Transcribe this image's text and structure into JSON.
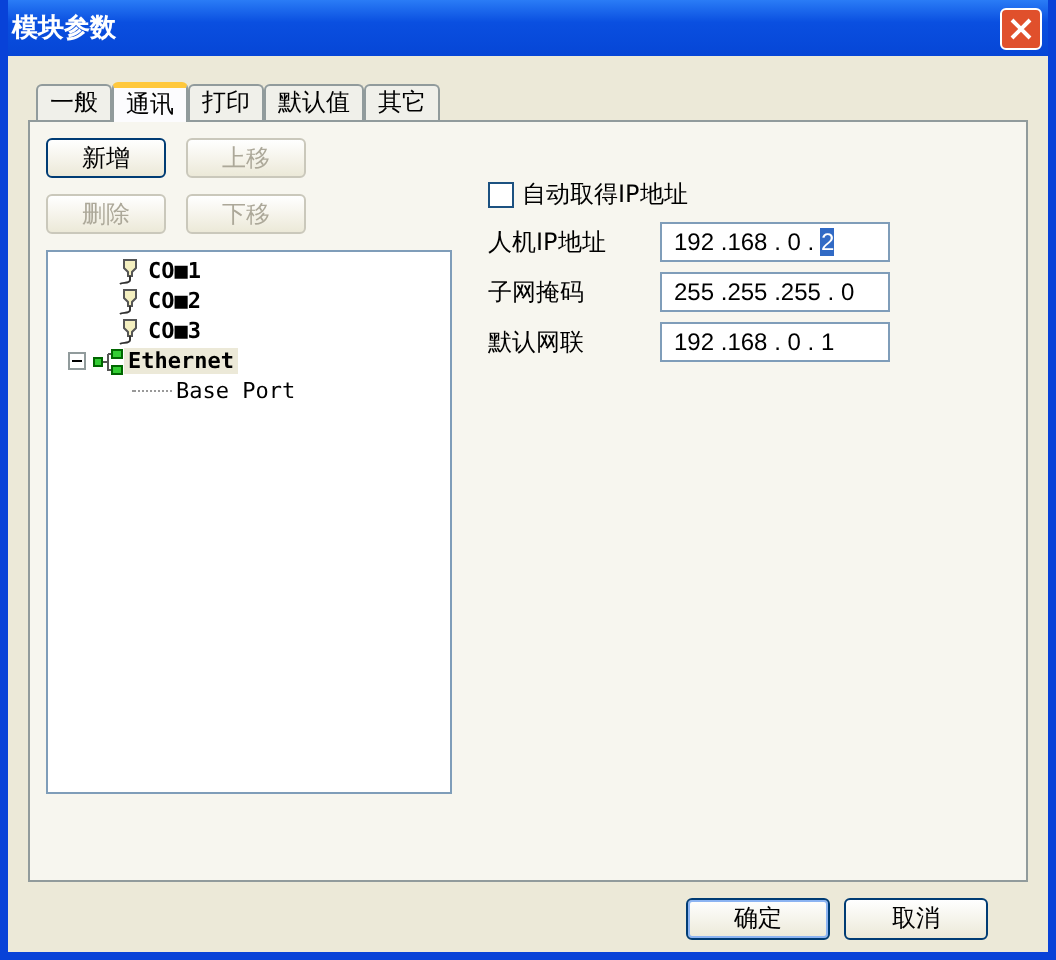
{
  "window": {
    "title": "模块参数"
  },
  "tabs": [
    {
      "label": "一般",
      "selected": false
    },
    {
      "label": "通讯",
      "selected": true
    },
    {
      "label": "打印",
      "selected": false
    },
    {
      "label": "默认值",
      "selected": false
    },
    {
      "label": "其它",
      "selected": false
    }
  ],
  "toolbar": [
    {
      "label": "新增",
      "disabled": false
    },
    {
      "label": "上移",
      "disabled": true
    },
    {
      "label": "删除",
      "disabled": true
    },
    {
      "label": "下移",
      "disabled": true
    }
  ],
  "tree": [
    {
      "label": "CO■1",
      "kind": "serial",
      "selected": false
    },
    {
      "label": "CO■2",
      "kind": "serial",
      "selected": false
    },
    {
      "label": "CO■3",
      "kind": "serial",
      "selected": false
    },
    {
      "label": "Ethernet",
      "kind": "network",
      "selected": true,
      "expanded": true,
      "children": [
        {
          "label": "Base Port",
          "kind": "port",
          "selected": false
        }
      ]
    }
  ],
  "auto_ip": {
    "label": "自动取得IP地址",
    "checked": false
  },
  "separator": ".",
  "fields": [
    {
      "label": "人机IP地址",
      "octets": [
        {
          "text": "192",
          "selected": false
        },
        {
          "text": "168",
          "selected": false
        },
        {
          "text": "0",
          "selected": false
        },
        {
          "text": "2",
          "selected": true
        }
      ]
    },
    {
      "label": "子网掩码",
      "octets": [
        {
          "text": "255",
          "selected": false
        },
        {
          "text": "255",
          "selected": false
        },
        {
          "text": "255",
          "selected": false
        },
        {
          "text": "0",
          "selected": false
        }
      ]
    },
    {
      "label": "默认网联",
      "octets": [
        {
          "text": "192",
          "selected": false
        },
        {
          "text": "168",
          "selected": false
        },
        {
          "text": "0",
          "selected": false
        },
        {
          "text": "1",
          "selected": false
        }
      ]
    }
  ],
  "buttons": [
    {
      "label": "确定",
      "default": true
    },
    {
      "label": "取消",
      "default": false
    }
  ]
}
